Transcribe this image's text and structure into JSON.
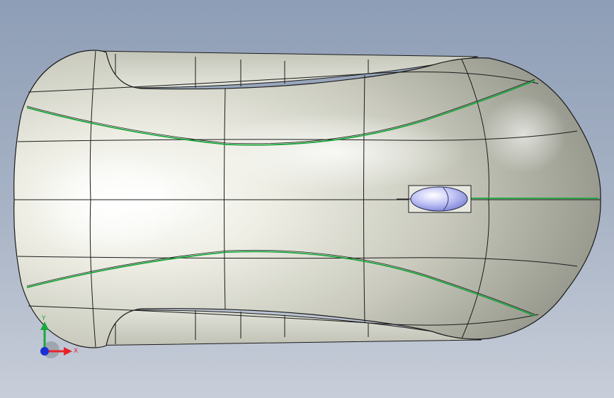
{
  "viewport": {
    "background_top": "#8e9eb6",
    "background_bottom": "#c8ced9"
  },
  "model": {
    "body_color": "#d6d7cc",
    "edge_color": "#1a1a1a",
    "accent_curve_color": "#17a53a",
    "scroll_wheel_color": "#b5b8f2"
  },
  "triad": {
    "x_label": "X",
    "y_label": "Y",
    "x_color": "#e8242a",
    "y_color": "#1aa83c",
    "z_color": "#1a2fd6"
  }
}
